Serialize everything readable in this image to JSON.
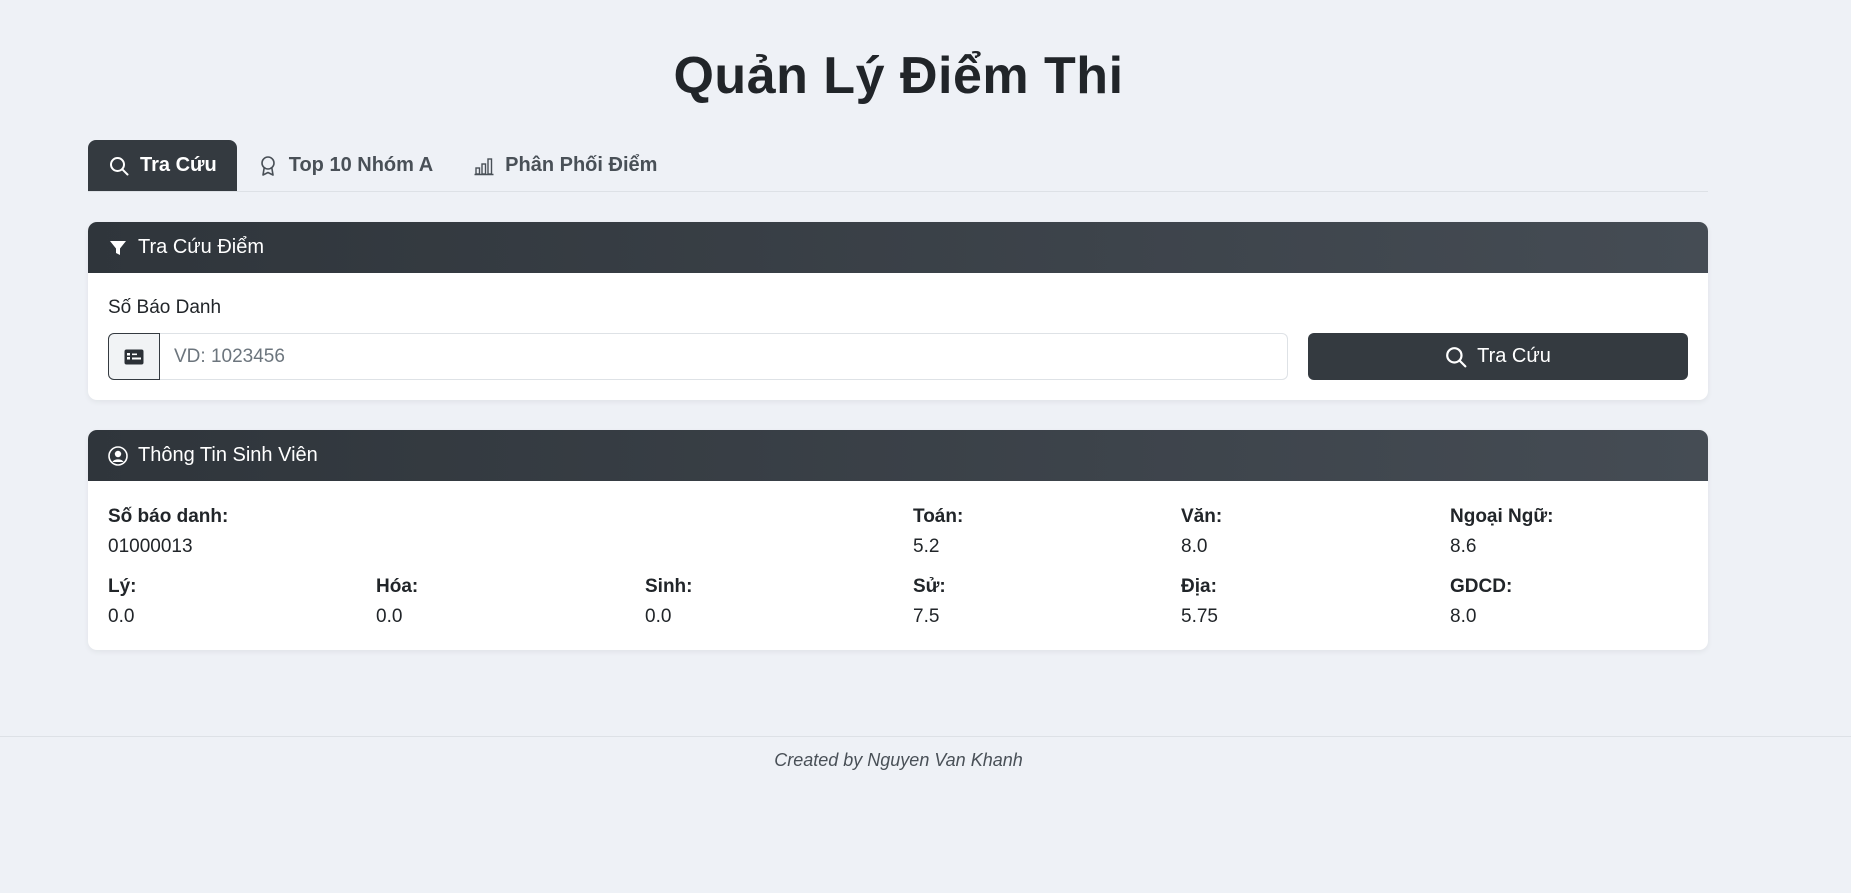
{
  "page": {
    "title": "Quản Lý Điểm Thi"
  },
  "tabs": [
    {
      "label": "Tra Cứu",
      "icon": "search-icon",
      "active": true
    },
    {
      "label": "Top 10 Nhóm A",
      "icon": "award-icon",
      "active": false
    },
    {
      "label": "Phân Phối Điểm",
      "icon": "bar-chart-icon",
      "active": false
    }
  ],
  "search_card": {
    "header": "Tra Cứu Điểm",
    "header_icon": "filter-icon",
    "field_label": "Số Báo Danh",
    "input_value": "",
    "input_placeholder": "VD: 1023456",
    "input_icon": "id-card-icon",
    "button_label": "Tra Cứu",
    "button_icon": "search-icon"
  },
  "info_card": {
    "header": "Thông Tin Sinh Viên",
    "header_icon": "user-circle-icon",
    "fields": {
      "sbd": {
        "label": "Số báo danh:",
        "value": "01000013"
      },
      "toan": {
        "label": "Toán:",
        "value": "5.2"
      },
      "van": {
        "label": "Văn:",
        "value": "8.0"
      },
      "ngoai_ngu": {
        "label": "Ngoại Ngữ:",
        "value": "8.6"
      },
      "ly": {
        "label": "Lý:",
        "value": "0.0"
      },
      "hoa": {
        "label": "Hóa:",
        "value": "0.0"
      },
      "sinh": {
        "label": "Sinh:",
        "value": "0.0"
      },
      "su": {
        "label": "Sử:",
        "value": "7.5"
      },
      "dia": {
        "label": "Địa:",
        "value": "5.75"
      },
      "gdcd": {
        "label": "GDCD:",
        "value": "8.0"
      }
    }
  },
  "footer": {
    "text": "Created by Nguyen Van Khanh"
  },
  "colors": {
    "background": "#eef1f6",
    "dark": "#343a40",
    "card": "#ffffff"
  }
}
